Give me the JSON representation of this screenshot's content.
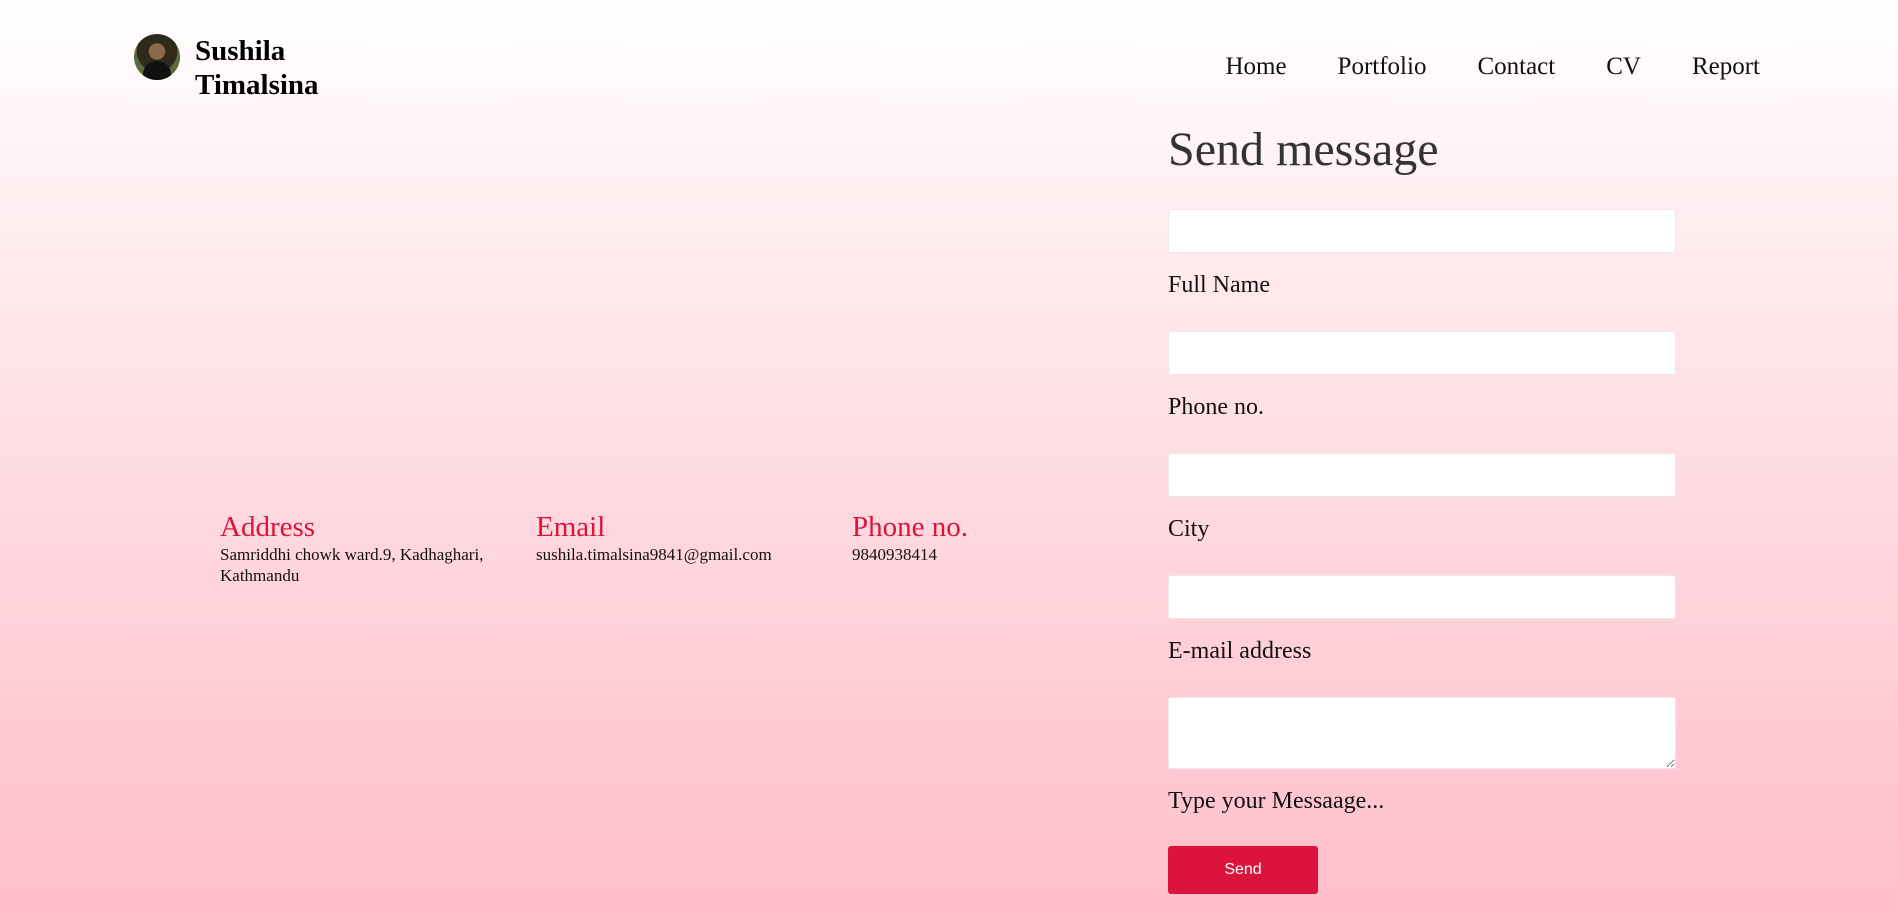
{
  "brand": {
    "name_line1": "Sushila",
    "name_line2": "Timalsina"
  },
  "nav": {
    "items": [
      "Home",
      "Portfolio",
      "Contact",
      "CV",
      "Report"
    ]
  },
  "contact_info": [
    {
      "title": "Address",
      "value": "Samriddhi chowk ward.9, Kadhaghari, Kathmandu"
    },
    {
      "title": "Email",
      "value": "sushila.timalsina9841@gmail.com"
    },
    {
      "title": "Phone no.",
      "value": "9840938414"
    }
  ],
  "form": {
    "title": "Send message",
    "fields": [
      {
        "label": "Full Name",
        "value": ""
      },
      {
        "label": "Phone no.",
        "value": ""
      },
      {
        "label": "City",
        "value": ""
      },
      {
        "label": "E-mail address",
        "value": ""
      }
    ],
    "message_label": "Type your Messaage...",
    "send_label": "Send"
  },
  "colors": {
    "accent": "#dc143c",
    "gradient_top": "#ffffff",
    "gradient_bottom": "#ffbfcb"
  }
}
